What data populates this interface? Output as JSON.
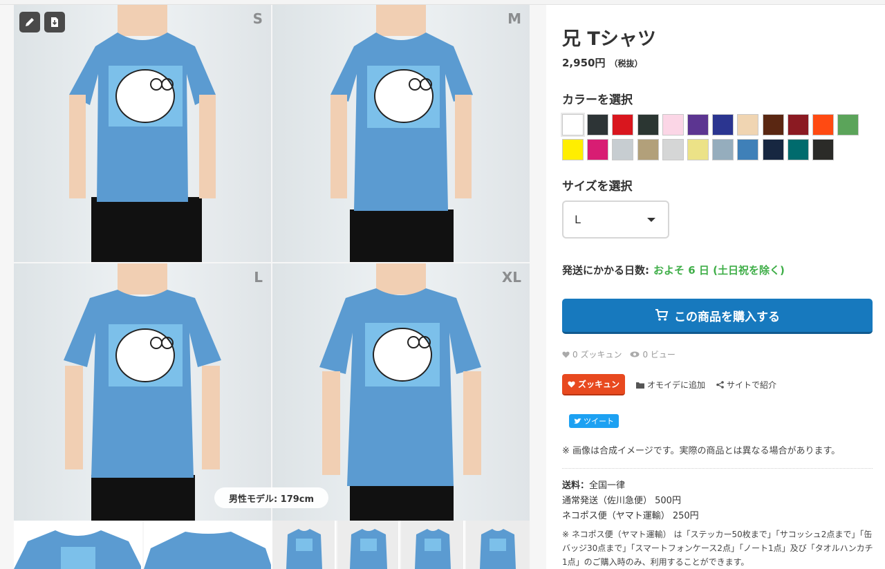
{
  "product": {
    "title": "兄 Tシャツ",
    "price": "2,950円",
    "tax_note": "（税抜）"
  },
  "gallery": {
    "tiles": [
      {
        "size_label": "S"
      },
      {
        "size_label": "M"
      },
      {
        "size_label": "L"
      },
      {
        "size_label": "XL"
      }
    ],
    "model_badge": "男性モデル: 179cm",
    "shirt_color": "#5b9bd1",
    "edit_icon": "pencil-icon",
    "download_icon": "download-icon",
    "thumbs": [
      "front",
      "back",
      "S",
      "M",
      "G-M",
      "WL"
    ]
  },
  "color_select": {
    "label": "カラーを選択",
    "colors": [
      "#ffffff",
      "#2d3436",
      "#d9161e",
      "#2b3632",
      "#fbd6e6",
      "#5c3591",
      "#2b3590",
      "#f0d5b2",
      "#5a2712",
      "#8b1a22",
      "#ff4a12",
      "#5ba45a",
      "#ffee00",
      "#d81d73",
      "#c7cdd1",
      "#b2a07a",
      "#d5d6d6",
      "#ece287",
      "#95adbd",
      "#3f80b8",
      "#172741",
      "#006b6d",
      "#2b2b28"
    ]
  },
  "size_select": {
    "label": "サイズを選択",
    "selected": "L"
  },
  "shipping_days": {
    "label": "発送にかかる日数:",
    "value": "およそ 6 日 (土日祝を除く)"
  },
  "buy_button": {
    "label": "この商品を購入する",
    "color": "#1779be"
  },
  "stats": {
    "likes": "0 ズッキュン",
    "views": "0 ビュー"
  },
  "actions": {
    "zukkyun": "ズッキュン",
    "favorite": "オモイデに追加",
    "share": "サイトで紹介"
  },
  "tweet": {
    "label": "ツイート"
  },
  "image_note": "※ 画像は合成イメージです。実際の商品とは異なる場合があります。",
  "shipping_fee": {
    "label": "送料：",
    "flat": "全国一律",
    "normal": "通常発送（佐川急便） 500円",
    "nekopos": "ネコポス便（ヤマト運輸） 250円",
    "note": "※ ネコポス便（ヤマト運輸） は「ステッカー50枚まで」「サコッシュ2点まで」「缶バッジ30点まで」「スマートフォンケース2点」「ノート1点」及び「タオルハンカチ1点」のご購入時のみ、利用することができます。"
  }
}
